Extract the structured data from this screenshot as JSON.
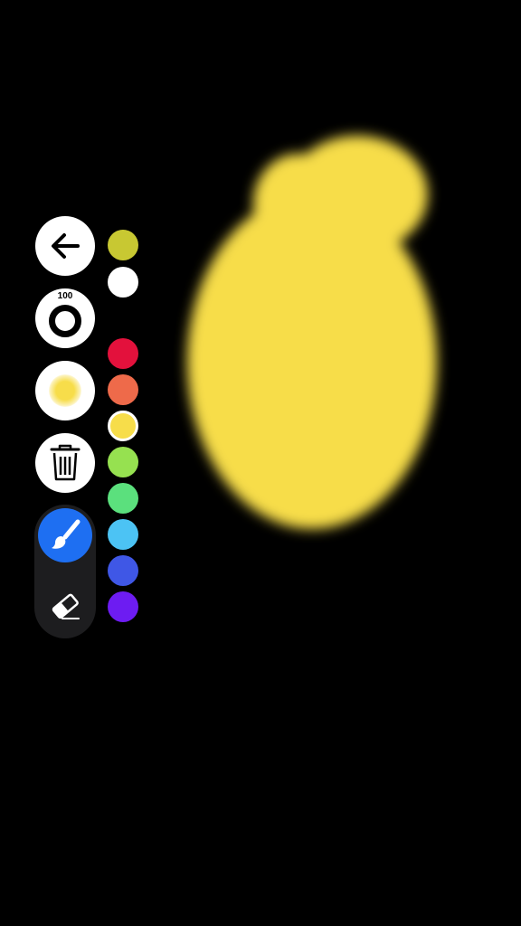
{
  "toolbar": {
    "back_icon": "arrow-left-icon",
    "brush_size_label": "100",
    "opacity_icon": "soft-dot-icon",
    "trash_icon": "trash-icon",
    "brush_icon": "paintbrush-icon",
    "eraser_icon": "eraser-icon",
    "active_tool": "brush",
    "accent_color": "#1e6ff2"
  },
  "palette": {
    "selected_index": 4,
    "colors": [
      "#c8c832",
      "#ffffff",
      "#e3113c",
      "#ee6a4a",
      "#f7dd4a",
      "#96e150",
      "#5be07d",
      "#4cc3f4",
      "#3f57e6",
      "#6d1cf2"
    ]
  },
  "canvas": {
    "background": "#000000",
    "stroke_color": "#f7dd4a"
  }
}
